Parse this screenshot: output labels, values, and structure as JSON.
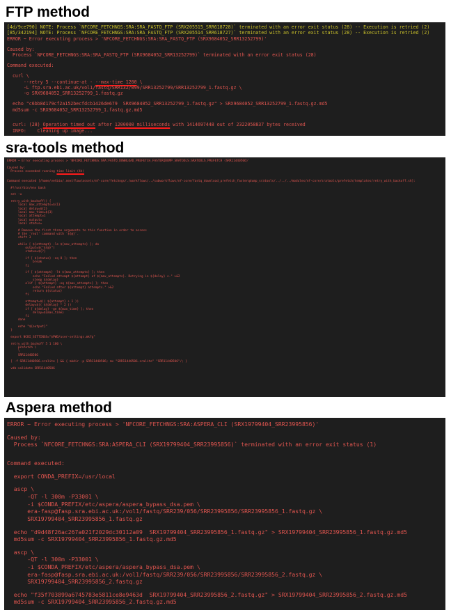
{
  "ftp": {
    "title": "FTP method",
    "lines": [
      {
        "t": "[4d/9ce790] NOTE: Process `NFCORE_FETCHNGS:SRA:SRA_FASTQ_FTP (SRX205515_SRR618728)` terminated with an error exit status (28) -- Execution is retried (2)",
        "c": "warn"
      },
      {
        "t": "[85/342194] NOTE: Process `NFCORE_FETCHNGS:SRA:SRA_FASTQ_FTP (SRX205514_SRR618727)` terminated with an error exit status (28) -- Execution is retried (2)",
        "c": "warn"
      },
      {
        "t": "ERROR ~ Error executing process > 'NFCORE_FETCHNGS:SRA:SRA_FASTQ_FTP (SRX9684052_SRR13252799)'"
      },
      {
        "t": ""
      },
      {
        "t": "Caused by:"
      },
      {
        "t": "  Process `NFCORE_FETCHNGS:SRA:SRA_FASTQ_FTP (SRX9684052_SRR13252799)` terminated with an error exit status (28)"
      },
      {
        "t": ""
      },
      {
        "t": "Command executed:"
      },
      {
        "t": ""
      },
      {
        "t": "  curl \\"
      },
      {
        "t": "      --retry 5 --continue-at - ",
        "u": "--max-time 1200",
        "after": " \\"
      },
      {
        "t": "      -L ftp.sra.ebi.ac.uk/vol1/fastq/SRR132/099/SRR13252799/SRR13252799_1.fastq.gz \\"
      },
      {
        "t": "      -o SRX9684052_SRR13252799_1.fastq.gz"
      },
      {
        "t": ""
      },
      {
        "t": "  echo \"c6bb8d179cf2a152becfdcb1426de679  SRX9684052_SRR13252799_1.fastq.gz\" > SRX9684052_SRR13252799_1.fastq.gz.md5"
      },
      {
        "t": "  md5sum -c SRX9684052_SRR13252799_1.fastq.gz.md5"
      },
      {
        "t": ""
      },
      {
        "t": ""
      },
      {
        "t": "  curl: (28) ",
        "u": "Operation timed out",
        "after": " after ",
        "u2": "1200000 milliseconds",
        "after2": " with 1414697448 out of 2322058837 bytes received"
      },
      {
        "t": "  INFO:    Cleaning up image..."
      }
    ]
  },
  "sra": {
    "title": "sra-tools method",
    "lines": [
      {
        "t": "ERROR ~ Error executing process > 'NFCORE_FETCHNGS:SRA:FASTQ_DOWNLOAD_PREFETCH_FASTERQDUMP_SRATOOLS:SRATOOLS_PREFETCH (SRR11440506)'"
      },
      {
        "t": ""
      },
      {
        "t": "Caused by:"
      },
      {
        "t": "  Process exceeded running ",
        "u": "time limit (4h)"
      },
      {
        "t": ""
      },
      {
        "t": ""
      },
      {
        "t": "Command executed [/home/vetbio/.nextflow/assets/nf-core/fetchngs/./workflows/../subworkflows/nf-core/fastq_download_prefetch_fasterqdump_sratools/../../../modules/nf-core/sratools/prefetch/templates/retry_with_backoff.sh]:"
      },
      {
        "t": ""
      },
      {
        "t": "  #!/usr/bin/env bash"
      },
      {
        "t": ""
      },
      {
        "t": "  set -u"
      },
      {
        "t": ""
      },
      {
        "t": "  retry_with_backoff() {"
      },
      {
        "t": "      local max_attempts=${1}"
      },
      {
        "t": "      local delay=${2}"
      },
      {
        "t": "      local max_time=${3}"
      },
      {
        "t": "      local attempt=1"
      },
      {
        "t": "      local output="
      },
      {
        "t": "      local status="
      },
      {
        "t": ""
      },
      {
        "t": "      # Remove the first three arguments to this function in order to access"
      },
      {
        "t": "      # the 'real' command with `${@}`."
      },
      {
        "t": "      shift 3"
      },
      {
        "t": ""
      },
      {
        "t": "      while [ ${attempt} -le ${max_attempts} ]; do"
      },
      {
        "t": "          output=$(\"${@}\")"
      },
      {
        "t": "          status=${?}"
      },
      {
        "t": ""
      },
      {
        "t": "          if [ ${status} -eq 0 ]; then"
      },
      {
        "t": "              break"
      },
      {
        "t": "          fi"
      },
      {
        "t": ""
      },
      {
        "t": "          if [ ${attempt} -lt ${max_attempts} ]; then"
      },
      {
        "t": "              echo \"Failed attempt ${attempt} of ${max_attempts}. Retrying in ${delay} s.\" >&2"
      },
      {
        "t": "              sleep ${delay}"
      },
      {
        "t": "          elif [ ${attempt} -eq ${max_attempts} ]; then"
      },
      {
        "t": "              echo \"Failed after ${attempt} attempts.\" >&2"
      },
      {
        "t": "              return ${status}"
      },
      {
        "t": "          fi"
      },
      {
        "t": ""
      },
      {
        "t": "          attempt=$(( ${attempt} + 1 ))"
      },
      {
        "t": "          delay=$(( ${delay} * 2 ))"
      },
      {
        "t": "          if [ ${delay} -ge ${max_time} ]; then"
      },
      {
        "t": "              delay=${max_time}"
      },
      {
        "t": "          fi"
      },
      {
        "t": "      done"
      },
      {
        "t": ""
      },
      {
        "t": "      echo \"${output}\""
      },
      {
        "t": "  }"
      },
      {
        "t": ""
      },
      {
        "t": "  export NCBI_SETTINGS=\"$PWD/user-settings.mkfg\""
      },
      {
        "t": ""
      },
      {
        "t": "  retry_with_backoff 5 1 100 \\"
      },
      {
        "t": "      prefetch \\"
      },
      {
        "t": "      \\"
      },
      {
        "t": "      SRR11440506"
      },
      {
        "t": ""
      },
      {
        "t": "  [ -f SRR11440506.sralite ] && { mkdir -p SRR11440506; mv \"SRR11440506.sralite\" \"SRR11440506\"/; }"
      },
      {
        "t": ""
      },
      {
        "t": "  vdb-validate SRR11440506"
      }
    ]
  },
  "aspera": {
    "title": "Aspera method",
    "lines": [
      {
        "t": "ERROR ~ Error executing process > 'NFCORE_FETCHNGS:SRA:ASPERA_CLI (SRX19799404_SRR23995856)'"
      },
      {
        "t": ""
      },
      {
        "t": "Caused by:"
      },
      {
        "t": "  Process `NFCORE_FETCHNGS:SRA:ASPERA_CLI (SRX19799404_SRR23995856)` terminated with an error exit status (1)"
      },
      {
        "t": ""
      },
      {
        "t": ""
      },
      {
        "t": "Command executed:"
      },
      {
        "t": ""
      },
      {
        "t": "  export CONDA_PREFIX=/usr/local"
      },
      {
        "t": ""
      },
      {
        "t": "  ascp \\"
      },
      {
        "t": "      -QT -l 300m -P33001 \\"
      },
      {
        "t": "      -i $CONDA_PREFIX/etc/aspera/aspera_bypass_dsa.pem \\"
      },
      {
        "t": "      era-fasp@fasp.sra.ebi.ac.uk:/vol1/fastq/SRR239/056/SRR23995856/SRR23995856_1.fastq.gz \\"
      },
      {
        "t": "      SRX19799404_SRR23995856_1.fastq.gz"
      },
      {
        "t": ""
      },
      {
        "t": "  echo \"d9d48f26ac267a021f2029dc30112a09  SRX19799404_SRR23995856_1.fastq.gz\" > SRX19799404_SRR23995856_1.fastq.gz.md5"
      },
      {
        "t": "  md5sum -c SRX19799404_SRR23995856_1.fastq.gz.md5"
      },
      {
        "t": ""
      },
      {
        "t": "  ascp \\"
      },
      {
        "t": "      -QT -l 300m -P33001 \\"
      },
      {
        "t": "      -i $CONDA_PREFIX/etc/aspera/aspera_bypass_dsa.pem \\"
      },
      {
        "t": "      era-fasp@fasp.sra.ebi.ac.uk:/vol1/fastq/SRR239/056/SRR23995856/SRR23995856_2.fastq.gz \\"
      },
      {
        "t": "      SRX19799404_SRR23995856_2.fastq.gz"
      },
      {
        "t": ""
      },
      {
        "t": "  echo \"f35f703899a6745783e5811ce8e9463d  SRX19799404_SRR23995856_2.fastq.gz\" > SRX19799404_SRR23995856_2.fastq.gz.md5"
      },
      {
        "t": "  md5sum -c SRX19799404_SRR23995856_2.fastq.gz.md5"
      }
    ]
  }
}
